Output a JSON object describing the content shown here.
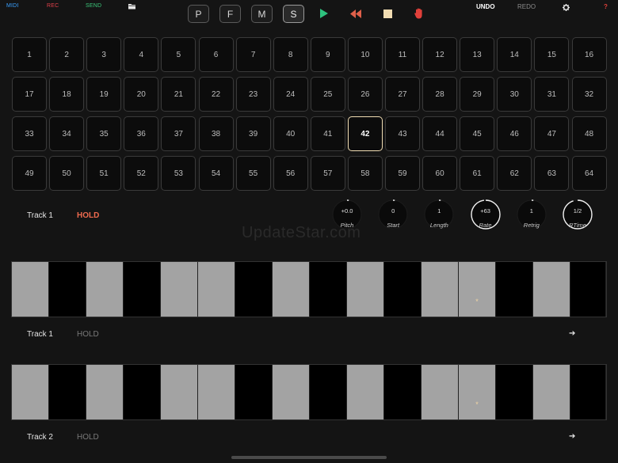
{
  "topbar": {
    "left": [
      {
        "label": "MIDI",
        "color": "#3aa0ff"
      },
      {
        "label": "REC",
        "color": "#e0404a"
      },
      {
        "label": "SEND",
        "color": "#3cc77a"
      }
    ],
    "folder_icon": "folder-icon",
    "modes": [
      "P",
      "F",
      "M",
      "S"
    ],
    "active_mode": "S",
    "transport": [
      {
        "name": "play-icon",
        "color": "#2ec27e"
      },
      {
        "name": "rewind-icon",
        "color": "#e0604a"
      },
      {
        "name": "stop-icon",
        "color": "#f1dcb2"
      },
      {
        "name": "hand-icon",
        "color": "#e0403a"
      }
    ],
    "undo": "UNDO",
    "redo": "REDO",
    "settings_icon": "gear-icon",
    "help": "?"
  },
  "pads": [
    "1",
    "2",
    "3",
    "4",
    "5",
    "6",
    "7",
    "8",
    "9",
    "10",
    "11",
    "12",
    "13",
    "14",
    "15",
    "16",
    "17",
    "18",
    "19",
    "20",
    "21",
    "22",
    "23",
    "24",
    "25",
    "26",
    "27",
    "28",
    "29",
    "30",
    "31",
    "32",
    "33",
    "34",
    "35",
    "36",
    "37",
    "38",
    "39",
    "40",
    "41",
    "42",
    "43",
    "44",
    "45",
    "46",
    "47",
    "48",
    "49",
    "50",
    "51",
    "52",
    "53",
    "54",
    "55",
    "56",
    "57",
    "58",
    "59",
    "60",
    "61",
    "62",
    "63",
    "64"
  ],
  "selected_pad": "42",
  "header": {
    "track": "Track 1",
    "mode": "HOLD"
  },
  "knobs": [
    {
      "value": "+0.0",
      "name": "Pitch",
      "level": 0.0
    },
    {
      "value": "0",
      "name": "Start",
      "level": 0.0
    },
    {
      "value": "1",
      "name": "Length",
      "level": 0.0
    },
    {
      "value": "+63",
      "name": "Rate",
      "level": 0.98
    },
    {
      "value": "1",
      "name": "Retrig",
      "level": 0.0
    },
    {
      "value": "1/2",
      "name": "RTime",
      "level": 0.95
    }
  ],
  "watermark": "UpdateStar.com",
  "tracks": [
    {
      "name": "Track 1",
      "mode": "HOLD",
      "arrow": "➔",
      "steps": [
        1,
        0,
        1,
        0,
        1,
        1,
        0,
        1,
        0,
        1,
        0,
        1,
        1,
        0,
        1,
        0
      ],
      "marker_step": 13,
      "marker": "*"
    },
    {
      "name": "Track 2",
      "mode": "HOLD",
      "arrow": "➔",
      "steps": [
        1,
        0,
        1,
        0,
        1,
        1,
        0,
        1,
        0,
        1,
        0,
        1,
        1,
        0,
        1,
        0
      ],
      "marker_step": 13,
      "marker": "*"
    }
  ]
}
